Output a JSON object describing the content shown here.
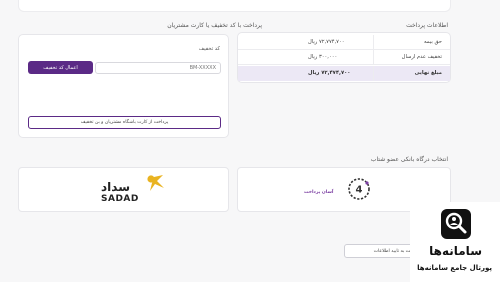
{
  "payment_info": {
    "title": "اطلاعات پرداخت",
    "rows": [
      {
        "label": "حق بیمه",
        "value": "۷۲,۷۷۴,۷۰۰ ریال"
      },
      {
        "label": "تخفیف عدم ارسال",
        "value": "۳۰۰,۰۰۰ ریال"
      },
      {
        "label": "مبلغ نهایی",
        "value": "۷۲,۴۷۴,۷۰۰ ریال"
      }
    ]
  },
  "discount": {
    "title": "پرداخت با کد تخفیف یا کارت مشتریان",
    "code_label": "کد تخفیف",
    "placeholder": "BM-XXXXX",
    "apply_label": "اعمال کد تخفیف",
    "club_label": "پرداخت از کارت باشگاه مشتریان و بن تخفیف"
  },
  "bank_gateway": {
    "title": "انتخاب درگاه بانکی عضو شتاب",
    "sadad": {
      "latin": "SADAD",
      "persian": "سداد"
    },
    "asan": {
      "persian": "آسان پرداخت"
    }
  },
  "footer": {
    "confirm_label": "بازگشت به تایید اطلاعات"
  },
  "watermark": {
    "brand": "سامانه‌ها",
    "tagline": "پورتال جامع سامانه‌ها"
  },
  "colors": {
    "accent": "#5b2a86",
    "total_row_bg": "#ece8f5",
    "sadad_yellow": "#e9b320"
  }
}
